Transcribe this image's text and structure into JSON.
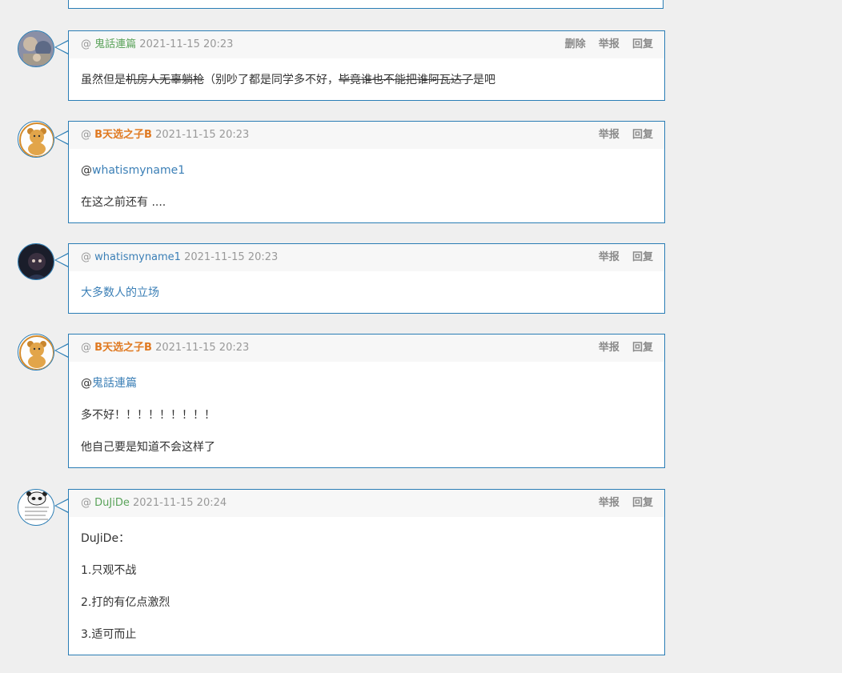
{
  "ui": {
    "at": "@",
    "reply": "回复",
    "report": "举报",
    "delete": "删除"
  },
  "comments": [
    {
      "user": "鬼話連篇",
      "time": "2021-11-15 20:23",
      "segments": [
        "虽然但是",
        "机房人无辜躺枪",
        "（别吵了都是同学多不好，",
        "毕竟谁也不能把谁阿瓦达了",
        "是吧"
      ]
    },
    {
      "user": "B天选之子B",
      "time": "2021-11-15 20:23",
      "mention_at": "@",
      "mention": "whatismyname1",
      "line": "在这之前还有 ...."
    },
    {
      "user": "whatismyname1",
      "time": "2021-11-15 20:23",
      "line": "大多数人的立场"
    },
    {
      "user": "B天选之子B",
      "time": "2021-11-15 20:23",
      "mention_at": "@",
      "mention": "鬼話連篇",
      "lines": [
        "多不好！！！！！！！！！",
        "他自己要是知道不会这样了"
      ]
    },
    {
      "user": "DuJiDe",
      "time": "2021-11-15 20:24",
      "lines": [
        "DuJiDe：",
        "1.只观不战",
        "2.打的有亿点激烈",
        "3.适可而止"
      ]
    }
  ]
}
